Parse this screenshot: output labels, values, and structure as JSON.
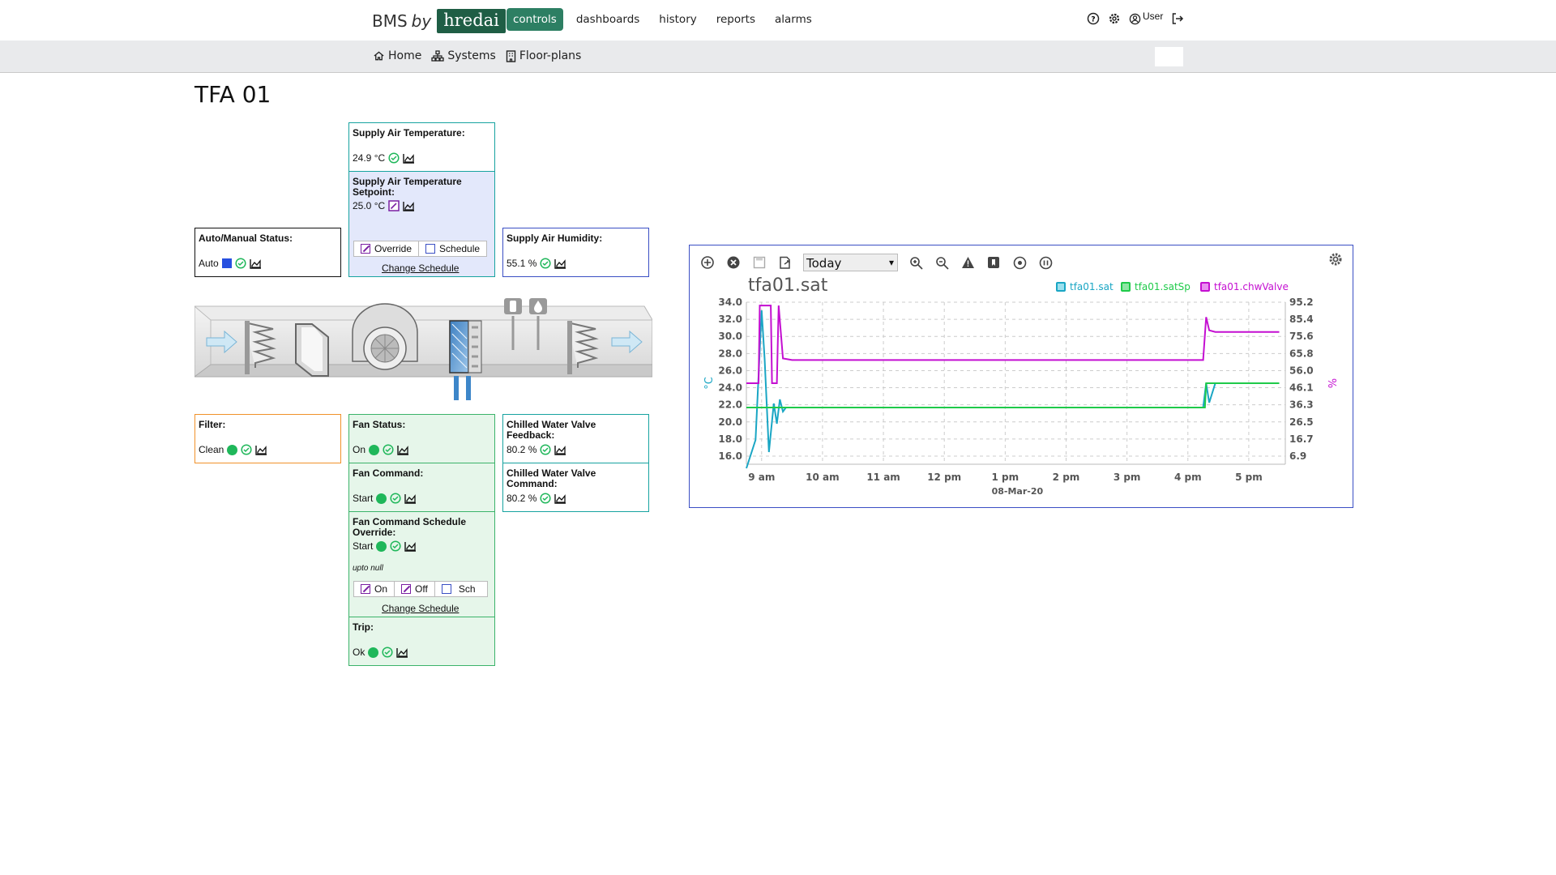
{
  "brand": {
    "prefix": "BMS",
    "by": "by",
    "logo": "hredai"
  },
  "nav": {
    "tabs": [
      "controls",
      "dashboards",
      "history",
      "reports",
      "alarms"
    ],
    "active": "controls"
  },
  "user": {
    "label": "User"
  },
  "subnav": {
    "home": "Home",
    "systems": "Systems",
    "floorplans": "Floor-plans"
  },
  "page": {
    "title": "TFA 01"
  },
  "cards": {
    "sat": {
      "label": "Supply Air Temperature:",
      "value": "24.9 °C"
    },
    "satsp": {
      "label": "Supply Air Temperature Setpoint:",
      "value": "25.0 °C",
      "override": "Override",
      "schedule": "Schedule",
      "change": "Change Schedule"
    },
    "auto": {
      "label": "Auto/Manual Status:",
      "value": "Auto"
    },
    "hum": {
      "label": "Supply Air Humidity:",
      "value": "55.1 %"
    },
    "filter": {
      "label": "Filter:",
      "value": "Clean"
    },
    "fanstatus": {
      "label": "Fan Status:",
      "value": "On"
    },
    "fancmd": {
      "label": "Fan Command:",
      "value": "Start"
    },
    "fansched": {
      "label": "Fan Command Schedule Override:",
      "value": "Start",
      "upto": "upto null",
      "on": "On",
      "off": "Off",
      "sch": "Sch",
      "change": "Change Schedule"
    },
    "trip": {
      "label": "Trip:",
      "value": "Ok"
    },
    "cwfb": {
      "label": "Chilled Water Valve Feedback:",
      "value": "80.2 %"
    },
    "cwcmd": {
      "label": "Chilled Water Valve Command:",
      "value": "80.2 %"
    }
  },
  "chart_toolbar": {
    "range": "Today"
  },
  "colors": {
    "sat": "#1aa6c4",
    "satSp": "#1fca4a",
    "chwValve": "#c40fd1",
    "brand": "#1f5e45"
  },
  "chart_data": {
    "type": "line",
    "title": "tfa01.sat",
    "x_tick_labels": [
      "9 am",
      "10 am",
      "11 am",
      "12 pm",
      "1 pm",
      "2 pm",
      "3 pm",
      "4 pm",
      "5 pm"
    ],
    "x_date_label": "08-Mar-20",
    "y_left": {
      "label": "°C",
      "ticks": [
        "34.0",
        "32.0",
        "30.0",
        "28.0",
        "26.0",
        "24.0",
        "22.0",
        "20.0",
        "18.0",
        "16.0"
      ],
      "range": [
        15,
        35
      ]
    },
    "y_right": {
      "label": "%",
      "ticks": [
        "95.2",
        "85.4",
        "75.6",
        "65.8",
        "56.0",
        "46.1",
        "36.3",
        "26.5",
        "16.7",
        "6.9"
      ],
      "range": [
        2,
        100
      ]
    },
    "x_range_hours": [
      8.75,
      17.6
    ],
    "series": [
      {
        "name": "tfa01.sat",
        "axis": "left",
        "x": [
          8.75,
          8.9,
          9.0,
          9.05,
          9.12,
          9.2,
          9.25,
          9.3,
          9.35,
          9.4,
          9.5,
          10,
          11,
          12,
          13,
          14,
          15,
          16,
          16.25,
          16.3,
          16.35,
          16.45,
          17,
          17.5
        ],
        "y": [
          14.5,
          18,
          34,
          28,
          16.5,
          22.5,
          20,
          23,
          21.5,
          22,
          22,
          22,
          22,
          22,
          22,
          22,
          22,
          22,
          22,
          25,
          22.6,
          25,
          25,
          25
        ]
      },
      {
        "name": "tfa01.satSp",
        "axis": "left",
        "x": [
          8.75,
          9.3,
          9.5,
          16.2,
          16.28,
          16.3,
          17.5
        ],
        "y": [
          22,
          22,
          22,
          22,
          22,
          25,
          25
        ]
      },
      {
        "name": "tfa01.chwValve",
        "axis": "right",
        "x": [
          8.75,
          8.95,
          8.97,
          9.15,
          9.17,
          9.25,
          9.28,
          9.35,
          9.5,
          10,
          11,
          12,
          13,
          14,
          15,
          16,
          16.25,
          16.3,
          16.35,
          16.45,
          17,
          17.5
        ],
        "y": [
          51,
          51,
          98,
          98,
          51,
          51,
          98,
          66,
          65,
          65,
          65,
          65,
          65,
          65,
          65,
          65,
          65,
          91,
          83,
          82,
          82,
          82
        ]
      }
    ]
  }
}
